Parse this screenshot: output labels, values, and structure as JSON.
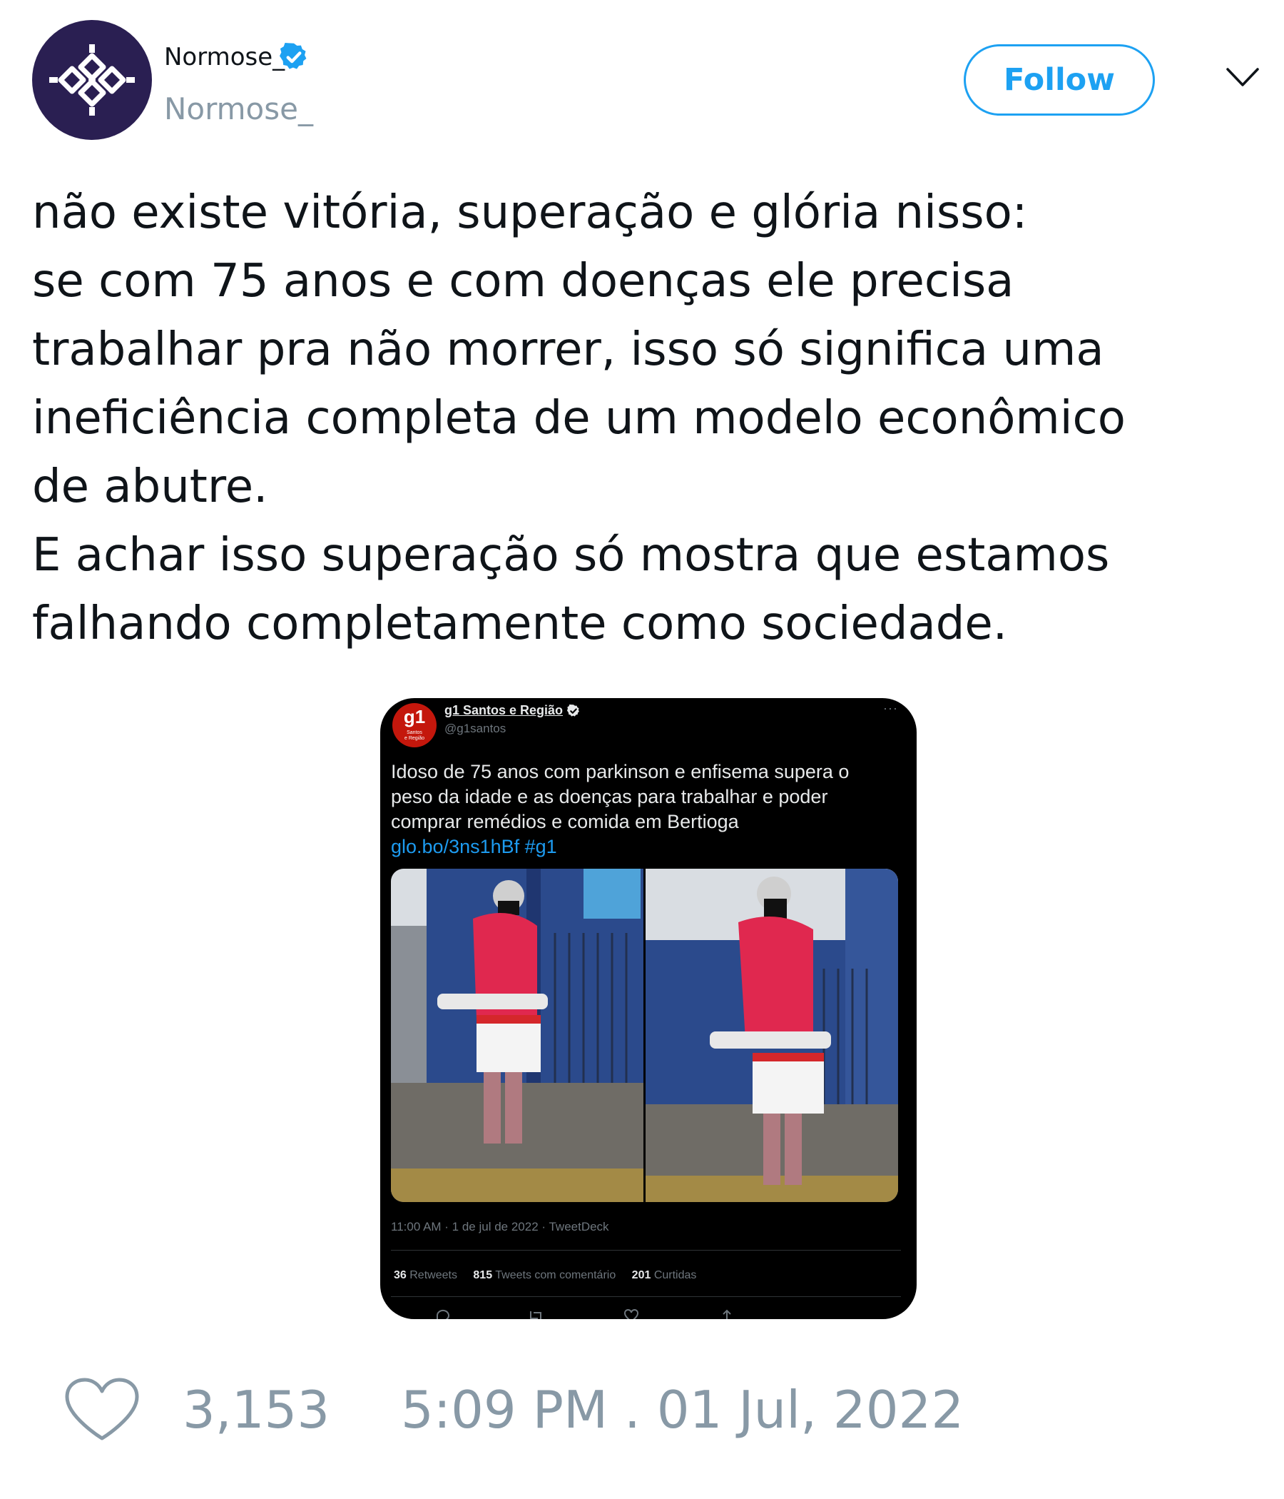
{
  "author": {
    "display_name": "Normose_",
    "handle": "Normose_",
    "verified": true,
    "avatar_icon": "interlace-pattern-icon",
    "avatar_color": "#2a1f52"
  },
  "follow_label": "Follow",
  "tweet": {
    "lines": [
      "não existe vitória, superação e glória nisso:",
      "se com 75 anos e com doenças ele precisa",
      "trabalhar pra não morrer, isso só significa uma",
      "ineficiência completa de um modelo econômico",
      "de abutre.",
      "E achar isso superação só mostra que estamos",
      "falhando completamente como sociedade."
    ]
  },
  "embedded_tweet": {
    "logo_text": "g1",
    "logo_sub_1": "Santos",
    "logo_sub_2": "e Região",
    "name": "g1 Santos e Região",
    "handle": "@g1santos",
    "lines": [
      "Idoso de 75 anos com parkinson e enfisema supera o",
      "peso da idade e as doenças para trabalhar e poder",
      "comprar remédios e comida em Bertioga"
    ],
    "link": "glo.bo/3ns1hBf #g1",
    "meta": "11:00 AM · 1 de jul de 2022 · TweetDeck",
    "stats": {
      "retweets_count": "36",
      "retweets_label": "Retweets",
      "quotes_count": "815",
      "quotes_label": "Tweets com comentário",
      "likes_count": "201",
      "likes_label": "Curtidas"
    },
    "brand_color": "#c4170c",
    "link_color": "#1d9bf0"
  },
  "footer": {
    "like_count": "3,153",
    "timestamp": "5:09 PM . 01 Jul, 2022"
  },
  "colors": {
    "accent": "#1da1f2",
    "muted": "#8899a6"
  }
}
